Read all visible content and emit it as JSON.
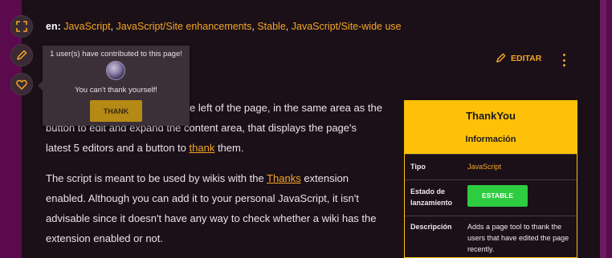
{
  "categories": {
    "prefix": "en:",
    "items": [
      "JavaScript",
      "JavaScript/Site enhancements",
      "Stable",
      "JavaScript/Site-wide use"
    ]
  },
  "tools": [
    {
      "name": "expand-icon"
    },
    {
      "name": "pencil-icon"
    },
    {
      "name": "heart-icon"
    }
  ],
  "popup": {
    "title": "1 user(s) have contributed to this page!",
    "message": "You can't thank yourself!",
    "button": "THANK"
  },
  "actions": {
    "edit": "EDITAR"
  },
  "article": {
    "p1_line1": "e left of the page, in the same area as the",
    "p1_line2": "button to edit and expand the content area, that displays the page's",
    "p1_line3_pre": "latest 5 editors and a button to ",
    "p1_line3_link": "thank",
    "p1_line3_post": " them.",
    "p2_line1_pre": "The script is meant to be used by wikis with the ",
    "p2_line1_link": "Thanks",
    "p2_line1_post": " extension",
    "p2_line2": "enabled. Although you can add it to your personal JavaScript, it isn't",
    "p2_line3": "advisable since it doesn't have any way to check whether a wiki has the",
    "p2_line4": "extension enabled or not."
  },
  "infobox": {
    "title": "ThankYou",
    "subtitle": "Información",
    "rows": [
      {
        "label": "Tipo",
        "value": "JavaScript"
      },
      {
        "label": "Estado de lanzamiento",
        "value": "ESTABLE"
      },
      {
        "label": "Descripción",
        "value": "Adds a page tool to thank the users that have edited the page recently."
      }
    ]
  },
  "colors": {
    "accent": "#f5a623",
    "background": "#1b1018",
    "frame": "#5a0a4d",
    "infobox_header": "#ffc107",
    "stable_badge": "#2ecc40",
    "thank_button": "#b58a14"
  }
}
